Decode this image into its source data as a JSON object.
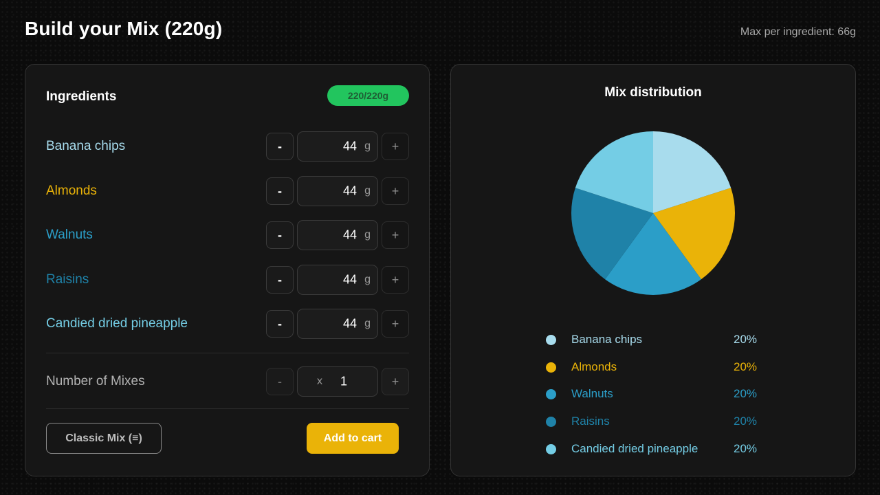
{
  "header": {
    "title": "Build your Mix (220g)",
    "max_note": "Max per ingredient: 66g"
  },
  "ingredients_panel": {
    "heading": "Ingredients",
    "total_badge": "220/220g",
    "minus_label": "-",
    "plus_label": "+",
    "unit": "g",
    "items": [
      {
        "name": "Banana chips",
        "qty": "44",
        "color": "#a8dced"
      },
      {
        "name": "Almonds",
        "qty": "44",
        "color": "#eab308"
      },
      {
        "name": "Walnuts",
        "qty": "44",
        "color": "#2b9ec8"
      },
      {
        "name": "Raisins",
        "qty": "44",
        "color": "#1f82a8"
      },
      {
        "name": "Candied dried pineapple",
        "qty": "44",
        "color": "#74cde5"
      }
    ],
    "mixes": {
      "label": "Number of Mixes",
      "multiplier": "x",
      "count": "1",
      "minus_label": "-",
      "plus_label": "+"
    },
    "classic_button": "Classic Mix (≡)",
    "cart_button": "Add to cart"
  },
  "distribution_panel": {
    "title": "Mix distribution"
  },
  "chart_data": {
    "type": "pie",
    "title": "Mix distribution",
    "categories": [
      "Banana chips",
      "Almonds",
      "Walnuts",
      "Raisins",
      "Candied dried pineapple"
    ],
    "values": [
      20,
      20,
      20,
      20,
      20
    ],
    "labels": [
      "20%",
      "20%",
      "20%",
      "20%",
      "20%"
    ],
    "colors": [
      "#a8dced",
      "#eab308",
      "#2b9ec8",
      "#1f82a8",
      "#74cde5"
    ],
    "legend": "bottom"
  }
}
